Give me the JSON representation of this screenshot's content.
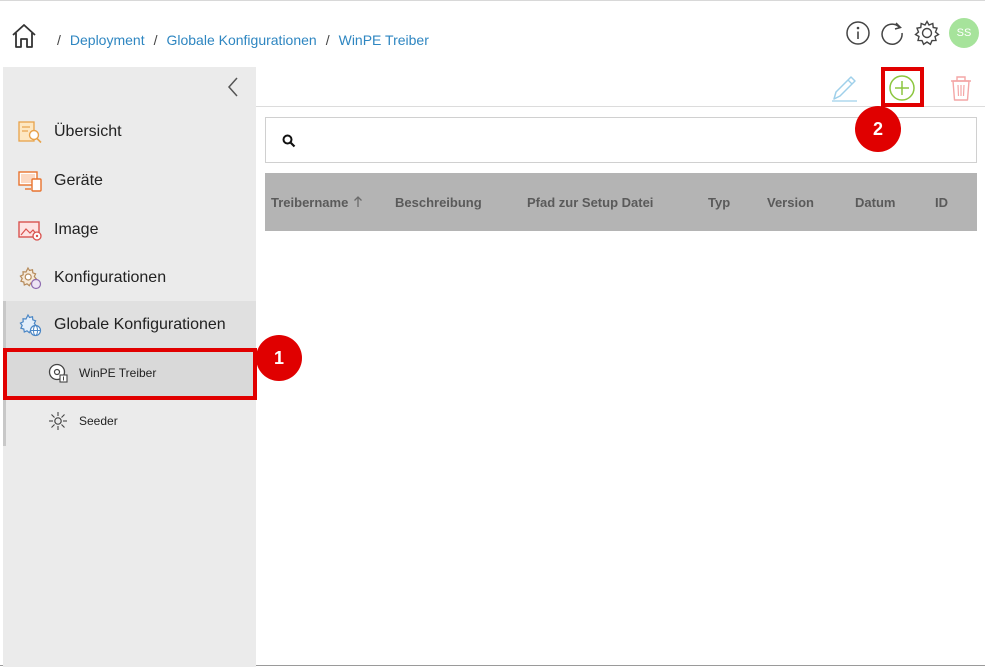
{
  "breadcrumb": {
    "separator": "/",
    "items": [
      "Deployment",
      "Globale Konfigurationen",
      "WinPE Treiber"
    ]
  },
  "header": {
    "icons": [
      "info-icon",
      "refresh-icon",
      "settings-icon"
    ],
    "avatar_initials": "SS",
    "avatar_color": "#a6e39b"
  },
  "sidebar": {
    "items": [
      {
        "label": "Übersicht",
        "icon": "overview-icon"
      },
      {
        "label": "Geräte",
        "icon": "devices-icon"
      },
      {
        "label": "Image",
        "icon": "image-icon"
      },
      {
        "label": "Konfigurationen",
        "icon": "configurations-icon"
      },
      {
        "label": "Globale Konfigurationen",
        "icon": "global-configurations-icon"
      }
    ],
    "subitems": [
      {
        "label": "WinPE Treiber",
        "icon": "driver-disc-icon"
      },
      {
        "label": "Seeder",
        "icon": "seeder-icon"
      }
    ]
  },
  "toolbar": {
    "edit_icon": "pencil-icon",
    "add_icon": "plus-circle-icon",
    "delete_icon": "trash-icon",
    "add_color": "#8cc63f",
    "edit_color": "#9fd0ea",
    "delete_color": "#f4a6a6"
  },
  "search": {
    "placeholder": ""
  },
  "table": {
    "columns": [
      "Treibername",
      "Beschreibung",
      "Pfad zur Setup Datei",
      "Typ",
      "Version",
      "Datum",
      "ID"
    ],
    "sort_column": "Treibername",
    "rows": []
  },
  "annotations": {
    "badge1": "1",
    "badge2": "2",
    "color": "#e00000"
  }
}
